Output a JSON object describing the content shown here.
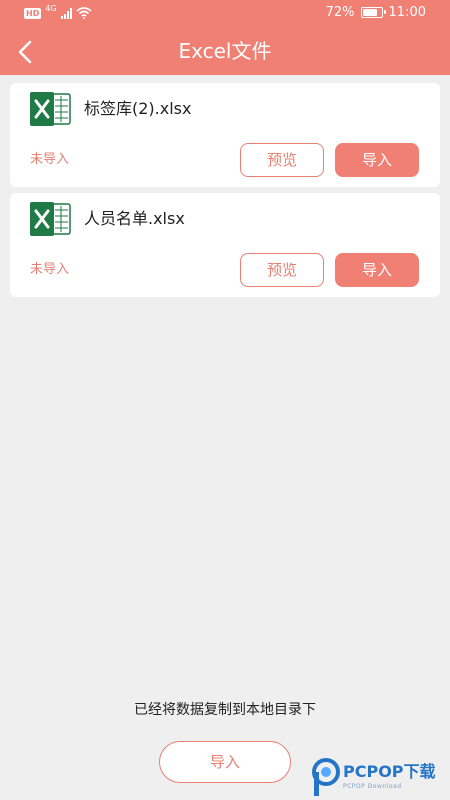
{
  "status_bar": {
    "network": "HD",
    "network_type": "4G",
    "battery_percent": "72%",
    "battery_level": 0.72,
    "time": "11:00"
  },
  "header": {
    "title": "Excel文件",
    "color": "#f07f74"
  },
  "files": [
    {
      "name": "标签库(2).xlsx",
      "status": "未导入",
      "preview_label": "预览",
      "import_label": "导入"
    },
    {
      "name": "人员名单.xlsx",
      "status": "未导入",
      "preview_label": "预览",
      "import_label": "导入"
    }
  ],
  "toast": "已经将数据复制到本地目录下",
  "bottom_import_label": "导入",
  "watermark": {
    "text": "PCPOP下载",
    "subtext": "PCPOP Download"
  }
}
